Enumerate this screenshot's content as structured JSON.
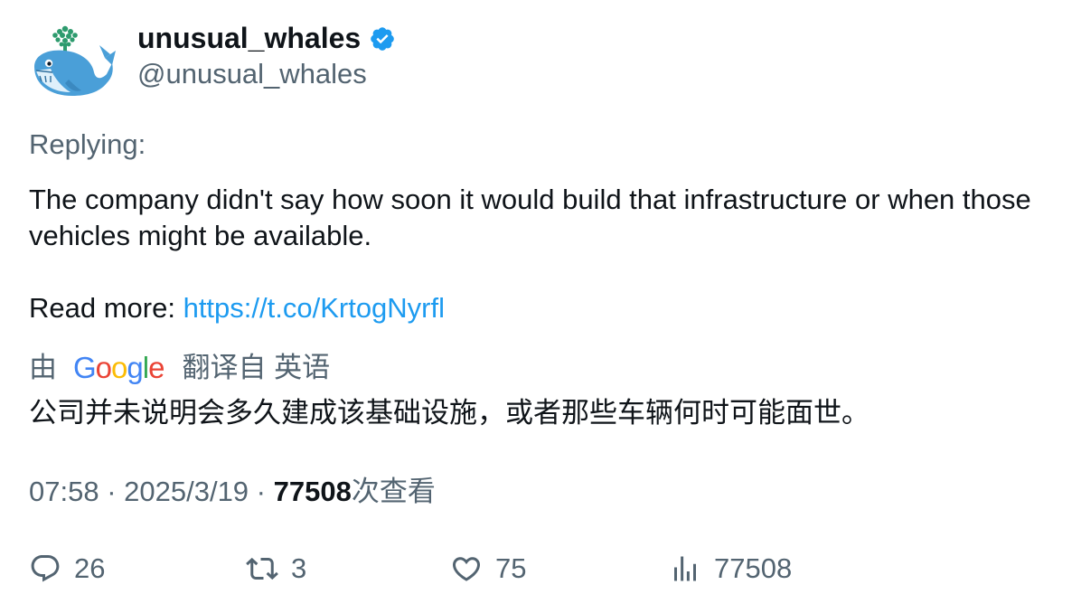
{
  "user": {
    "display_name": "unusual_whales",
    "handle": "@unusual_whales",
    "verified": true,
    "avatar_icon": "whale-icon"
  },
  "tweet": {
    "replying_label": "Replying:",
    "text_paragraph": "The company didn't say how soon it would build that infrastructure or when those vehicles might be available.",
    "read_more_label": "Read more: ",
    "link_text": "https://t.co/KrtogNyrfl"
  },
  "translation": {
    "by_label": "由",
    "google_letters": [
      "G",
      "o",
      "o",
      "g",
      "l",
      "e"
    ],
    "google_colors": [
      "#4285F4",
      "#EA4335",
      "#FBBC05",
      "#4285F4",
      "#34A853",
      "#EA4335"
    ],
    "translated_from_label": "翻译自 英语",
    "translated_text": "公司并未说明会多久建成该基础设施，或者那些车辆何时可能面世。"
  },
  "meta": {
    "time": "07:58",
    "separator": " · ",
    "date": "2025/3/19",
    "views_count": "77508",
    "views_label": "次查看"
  },
  "actions": {
    "replies": "26",
    "retweets": "3",
    "likes": "75",
    "views": "77508"
  },
  "colors": {
    "text_primary": "#0f1419",
    "text_secondary": "#536471",
    "link": "#1d9bf0",
    "verified": "#1d9bf0"
  }
}
